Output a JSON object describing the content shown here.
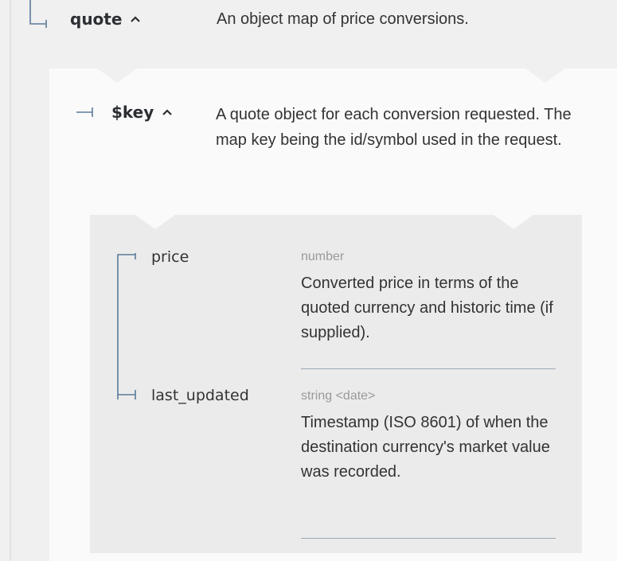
{
  "quote": {
    "name": "quote",
    "description": "An object map of price conversions."
  },
  "key": {
    "name": "$key",
    "description": "A quote object for each conversion requested. The map key being the id/symbol used in the request."
  },
  "fields": [
    {
      "name": "price",
      "type": "number",
      "description": "Converted price in terms of the quoted currency and historic time (if supplied)."
    },
    {
      "name": "last_updated",
      "type": "string <date>",
      "description": "Timestamp (ISO 8601) of when the destination currency's market value was recorded."
    }
  ],
  "colors": {
    "connector": "#5a7a9a",
    "panel1": "#fafafa",
    "panel2": "#ebebeb",
    "background": "#f0f0f0",
    "divider": "#9aa7b5"
  }
}
